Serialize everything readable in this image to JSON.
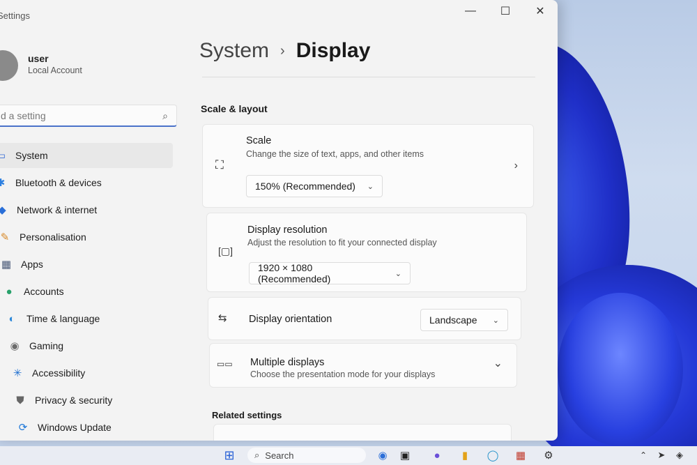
{
  "window": {
    "app_title": "Settings",
    "minimize": "—",
    "maximize": "☐",
    "close": "✕"
  },
  "user": {
    "name": "user",
    "account_type": "Local Account"
  },
  "search": {
    "value": "d a setting",
    "placeholder": "Find a setting",
    "icon": "⌕"
  },
  "sidebar": {
    "items": [
      {
        "label": "System",
        "icon": "▭",
        "icon_name": "system-icon",
        "color": "#3b6fd6",
        "active": true
      },
      {
        "label": "Bluetooth & devices",
        "icon": "✱",
        "icon_name": "bluetooth-icon",
        "color": "#2c7fe0",
        "active": false
      },
      {
        "label": "Network & internet",
        "icon": "◆",
        "icon_name": "wifi-icon",
        "color": "#2a6fd8",
        "active": false
      },
      {
        "label": "Personalisation",
        "icon": "✎",
        "icon_name": "brush-icon",
        "color": "#d8892a",
        "active": false
      },
      {
        "label": "Apps",
        "icon": "▦",
        "icon_name": "apps-icon",
        "color": "#4a5a78",
        "active": false
      },
      {
        "label": "Accounts",
        "icon": "●",
        "icon_name": "person-icon",
        "color": "#28a16b",
        "active": false
      },
      {
        "label": "Time & language",
        "icon": "◐",
        "icon_name": "globe-clock-icon",
        "color": "#2c88d9",
        "active": false
      },
      {
        "label": "Gaming",
        "icon": "◉",
        "icon_name": "controller-icon",
        "color": "#6b6b6b",
        "active": false
      },
      {
        "label": "Accessibility",
        "icon": "✳",
        "icon_name": "accessibility-icon",
        "color": "#1f6fd0",
        "active": false
      },
      {
        "label": "Privacy & security",
        "icon": "⛊",
        "icon_name": "shield-icon",
        "color": "#666666",
        "active": false
      },
      {
        "label": "Windows Update",
        "icon": "⟳",
        "icon_name": "update-icon",
        "color": "#1f78d8",
        "active": false
      }
    ]
  },
  "breadcrumb": {
    "parent": "System",
    "separator": "›",
    "current": "Display"
  },
  "scale_layout": {
    "title": "Scale & layout",
    "scale": {
      "title": "Scale",
      "description": "Change the size of text, apps, and other items",
      "value": "150% (Recommended)",
      "icon": "⛶",
      "chevron": "›"
    },
    "resolution": {
      "title": "Display resolution",
      "description": "Adjust the resolution to fit your connected display",
      "value": "1920 × 1080 (Recommended)",
      "icon": "[▢]"
    },
    "orientation": {
      "title": "Display orientation",
      "value": "Landscape",
      "icon": "⇆"
    },
    "multiple": {
      "title": "Multiple displays",
      "description": "Choose the presentation mode for your displays",
      "icon": "▭▭",
      "chevron": "⌄"
    }
  },
  "related": {
    "title": "Related settings"
  },
  "taskbar": {
    "search_label": "Search",
    "search_icon": "⌕",
    "start_icon": "⊞",
    "accent": "#2a62d6"
  },
  "colors": {
    "accent": "#4a72c9",
    "window_bg": "#f3f3f3",
    "card_bg": "#fbfbfb"
  }
}
